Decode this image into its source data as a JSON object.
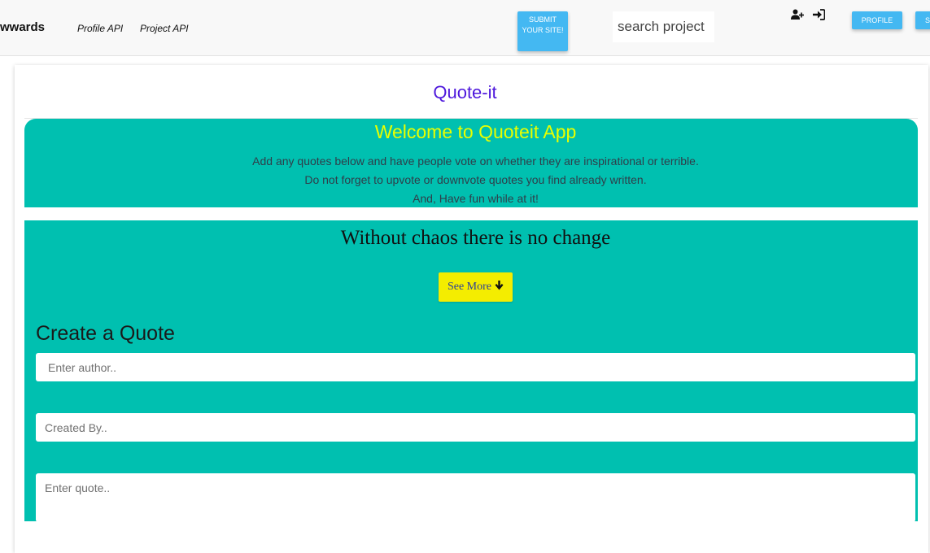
{
  "navbar": {
    "brand": "wwards",
    "links": [
      "Profile API",
      "Project API"
    ],
    "submit_label": "SUBMIT YOUR SITE!",
    "search_placeholder": "search project",
    "profile_label": "PROFILE",
    "extra_label": "S",
    "icons": [
      "user-plus-icon",
      "sign-in-icon"
    ],
    "accent_color": "#44b8f2"
  },
  "card": {
    "title": "Quote-it",
    "title_color": "#4e18dc"
  },
  "jumbotron": {
    "title": "Welcome to Quoteit App",
    "lines": [
      "Add any quotes below and have people vote on whether they are inspirational or terrible.",
      "Do not forget to upvote or downvote quotes you find already written.",
      "And, Have fun while at it!"
    ],
    "bg_color": "#00c0b0",
    "title_color": "#e8ff00"
  },
  "quote": {
    "text": "Without chaos there is no change",
    "see_more_label": "See More"
  },
  "form": {
    "title": "Create a Quote",
    "author_placeholder": "Enter author..",
    "created_by_placeholder": "Created By..",
    "quote_placeholder": "Enter quote.."
  }
}
